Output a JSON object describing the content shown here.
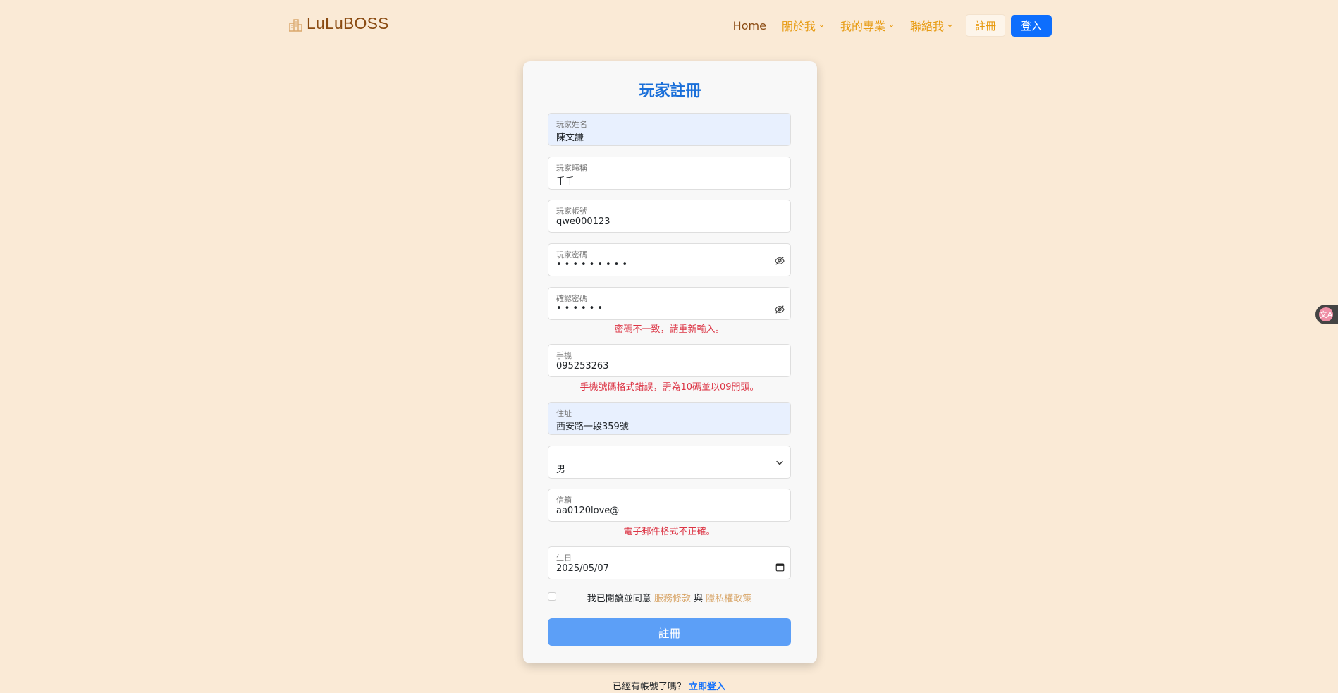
{
  "brand": {
    "name": "LuLuBOSS"
  },
  "nav": {
    "home": "Home",
    "about": "關於我",
    "projects": "我的專業",
    "contact": "聯絡我",
    "register": "註冊",
    "login": "登入"
  },
  "form": {
    "title": "玩家註冊",
    "name": {
      "label": "玩家姓名",
      "value": "陳文謙"
    },
    "nickname": {
      "label": "玩家暱稱",
      "value": "千千"
    },
    "account": {
      "label": "玩家帳號",
      "value": "qwe000123"
    },
    "password": {
      "label": "玩家密碼",
      "value": "•••••••••"
    },
    "confirm": {
      "label": "確認密碼",
      "value": "••••••",
      "error": "密碼不一致，請重新輸入。"
    },
    "phone": {
      "label": "手機",
      "value": "095253263",
      "error": "手機號碼格式錯誤，需為10碼並以09開頭。"
    },
    "address": {
      "label": "住址",
      "value": "西安路一段359號"
    },
    "gender": {
      "value": "男"
    },
    "email": {
      "label": "信箱",
      "value": "aa0120love@",
      "error": "電子郵件格式不正確。"
    },
    "birthday": {
      "label": "生日",
      "value": "2025/05/07"
    },
    "agree": {
      "prefix": "我已閱讀並同意",
      "terms": "服務條款",
      "and": "與",
      "privacy": "隱私權政策",
      "checked": false
    },
    "submit": "註冊"
  },
  "footer": {
    "text": "已經有帳號了嗎？",
    "link": "立即登入"
  },
  "colors": {
    "accent": "#0d6efd",
    "brand": "#8a4b12",
    "nav": "#e79a10",
    "error": "#dc3545",
    "background": "#faead6"
  },
  "translate_widget": {
    "icon": "translate-icon",
    "glyph": "文A"
  }
}
